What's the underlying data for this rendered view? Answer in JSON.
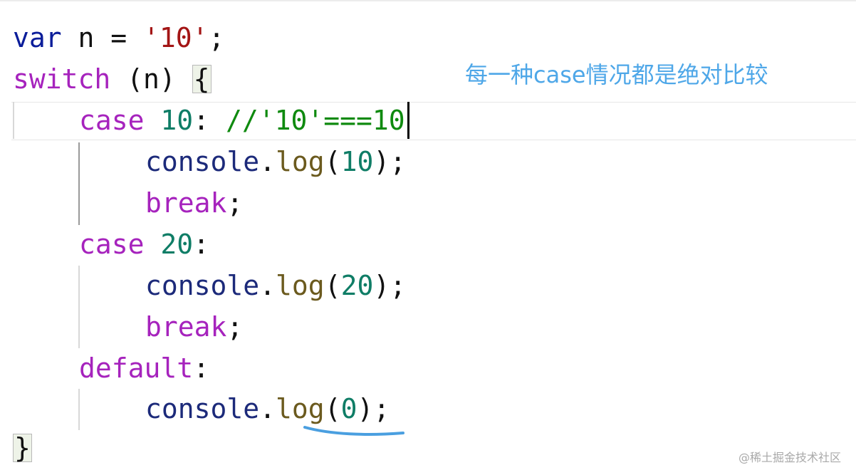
{
  "editor": {
    "lines": [
      {
        "tokens": [
          "var",
          " n ",
          "= ",
          "'10'",
          ";"
        ]
      },
      {
        "tokens": [
          "switch",
          " (n) ",
          "{"
        ]
      },
      {
        "tokens": [
          "case",
          " ",
          "10",
          ": ",
          "//'10'===10"
        ]
      },
      {
        "tokens": [
          "console",
          ".",
          "log",
          "(",
          "10",
          ");"
        ]
      },
      {
        "tokens": [
          "break",
          ";"
        ]
      },
      {
        "tokens": [
          "case",
          " ",
          "20",
          ":"
        ]
      },
      {
        "tokens": [
          "console",
          ".",
          "log",
          "(",
          "20",
          ");"
        ]
      },
      {
        "tokens": [
          "break",
          ";"
        ]
      },
      {
        "tokens": [
          "default",
          ":"
        ]
      },
      {
        "tokens": [
          "console",
          ".",
          "log",
          "(",
          "0",
          ");"
        ]
      },
      {
        "tokens": [
          "}"
        ]
      }
    ]
  },
  "annotation": "每一种case情况都是绝对比较",
  "watermark": "@稀土掘金技术社区",
  "colors": {
    "keyword_blue": "#0b1d9a",
    "keyword_purple": "#a623bd",
    "number": "#0f7d66",
    "string": "#a31515",
    "comment": "#0f8a0f",
    "annotation": "#4ea7e8",
    "underline_mark": "#4a9fe0"
  }
}
